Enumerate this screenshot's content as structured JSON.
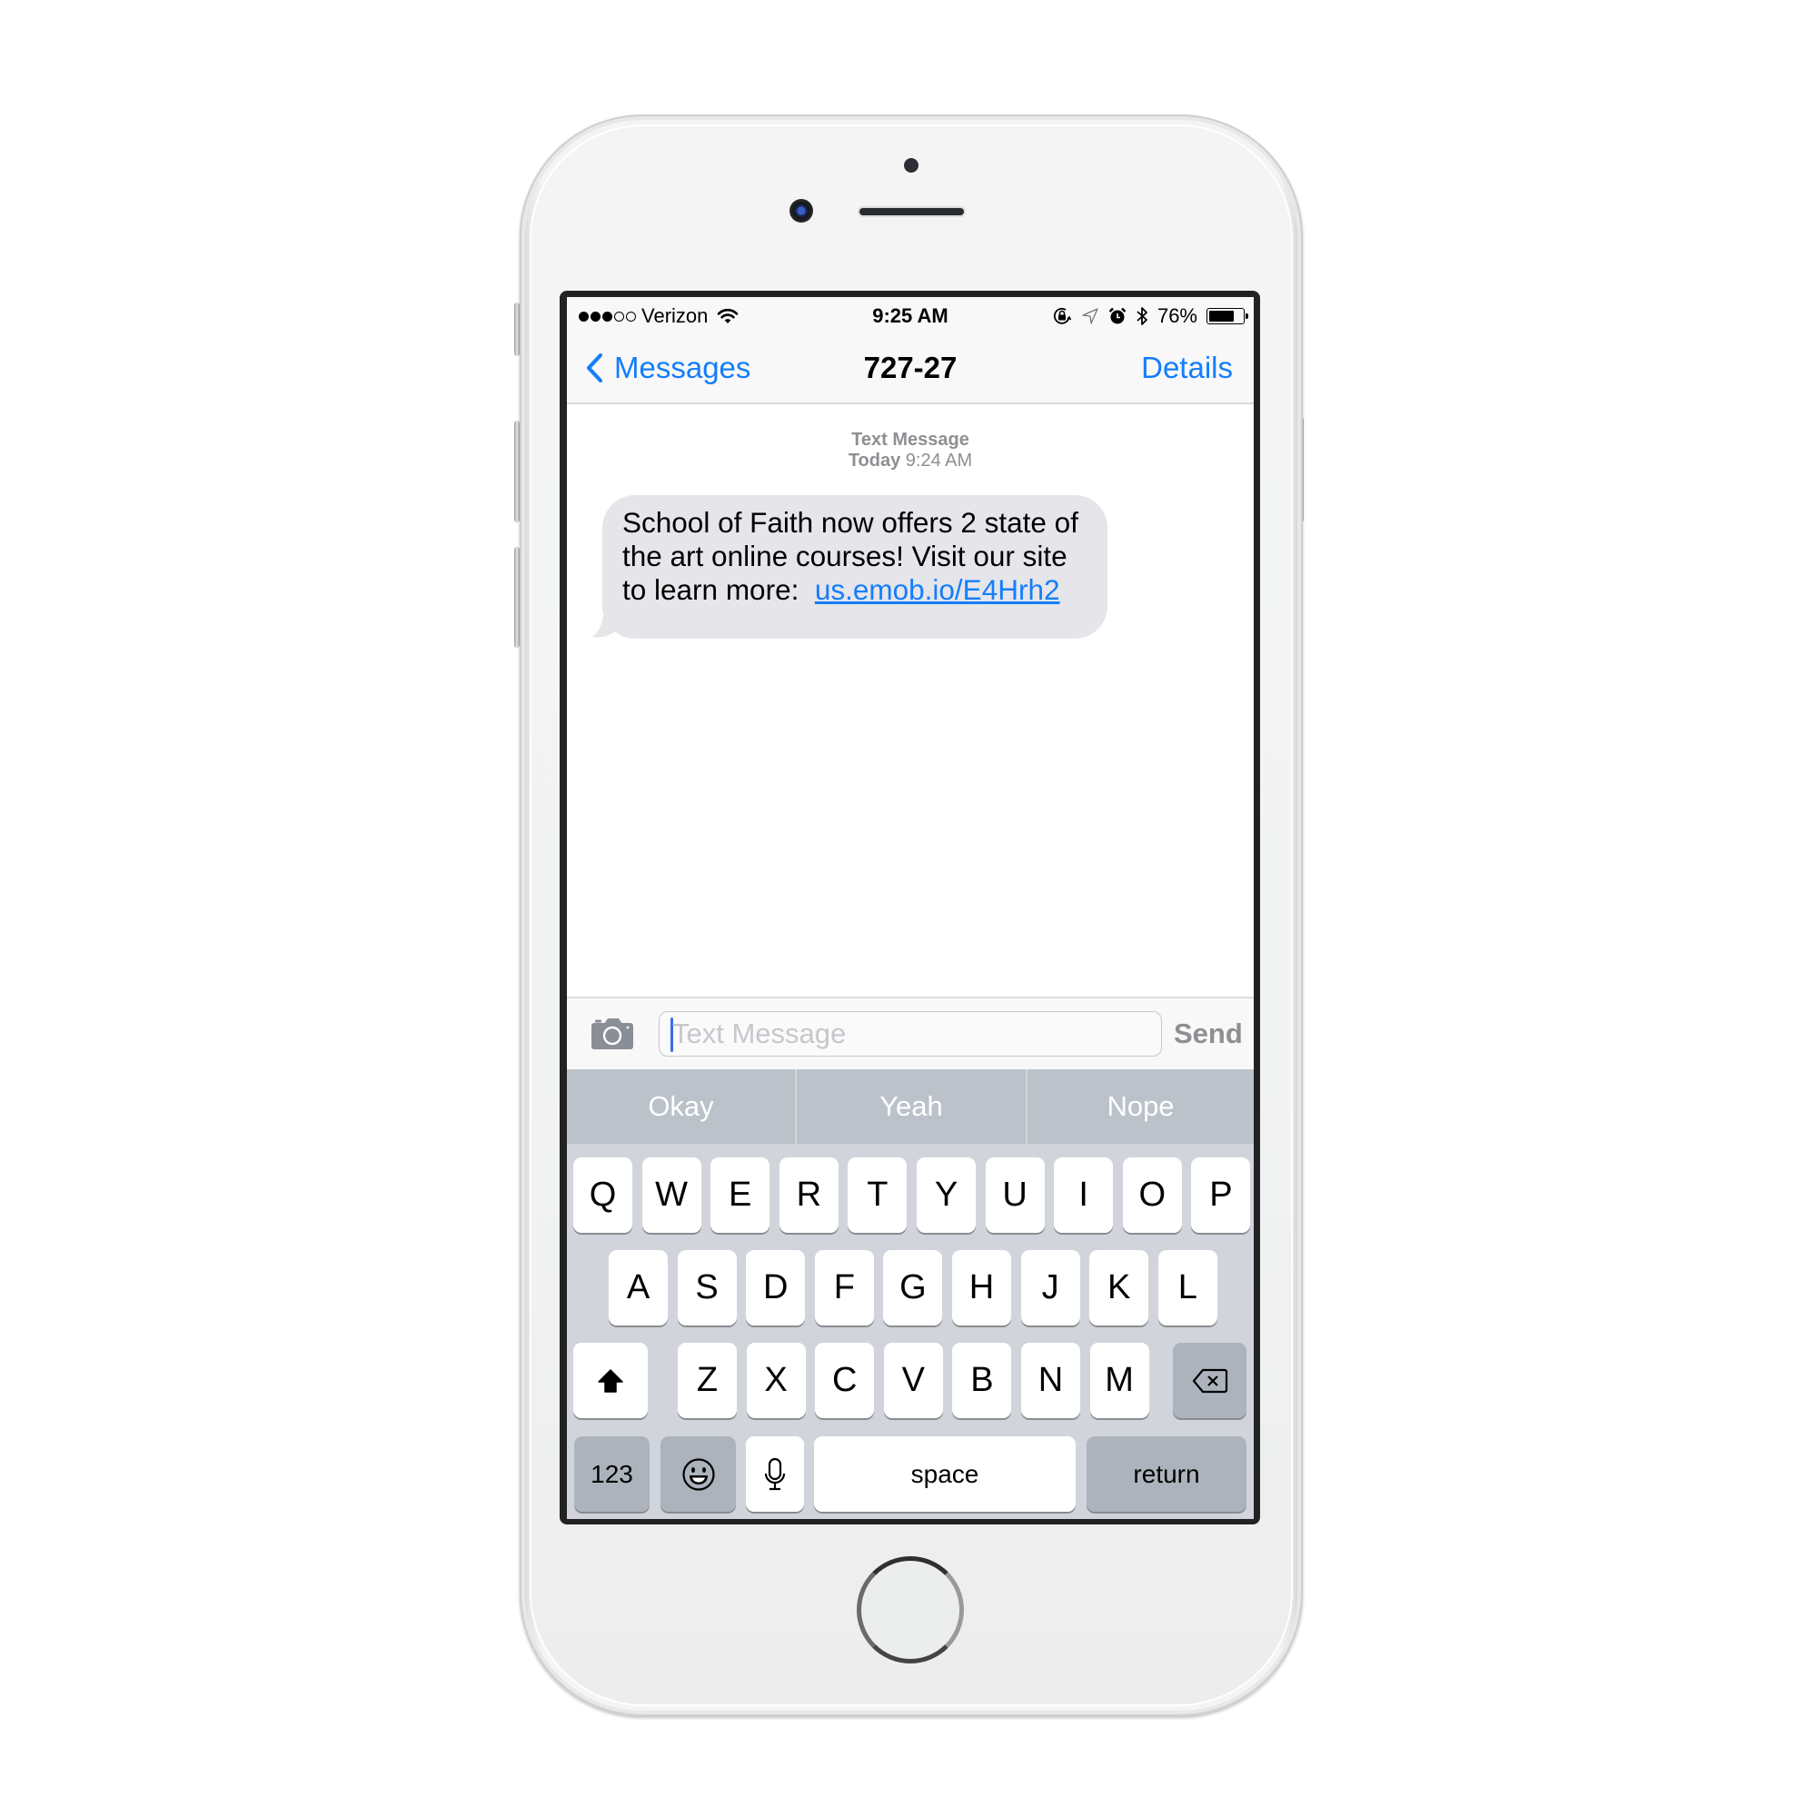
{
  "status_bar": {
    "signal_bars_filled": 3,
    "signal_bars_total": 5,
    "carrier": "Verizon",
    "time": "9:25 AM",
    "battery_text": "76%",
    "battery_level": 0.76,
    "icons": [
      "wifi-icon",
      "rotation-lock-icon",
      "location-icon",
      "alarm-icon",
      "bluetooth-icon",
      "battery-icon"
    ]
  },
  "nav": {
    "back_label": "Messages",
    "title": "727-27",
    "details_label": "Details"
  },
  "conversation": {
    "header_type": "Text Message",
    "header_day": "Today",
    "header_time": "9:24 AM",
    "messages": [
      {
        "direction": "incoming",
        "text_before_link": "School of Faith now offers 2 state of the art online courses! Visit our site to learn more:  ",
        "link_text": "us.emob.io/E4Hrh2"
      }
    ]
  },
  "composer": {
    "placeholder": "Text Message",
    "value": "",
    "send_label": "Send"
  },
  "quicktype": [
    "Okay",
    "Yeah",
    "Nope"
  ],
  "keyboard": {
    "row1": [
      "Q",
      "W",
      "E",
      "R",
      "T",
      "Y",
      "U",
      "I",
      "O",
      "P"
    ],
    "row2": [
      "A",
      "S",
      "D",
      "F",
      "G",
      "H",
      "J",
      "K",
      "L"
    ],
    "row3": [
      "Z",
      "X",
      "C",
      "V",
      "B",
      "N",
      "M"
    ],
    "numbers_label": "123",
    "space_label": "space",
    "return_label": "return"
  },
  "colors": {
    "accent": "#147efb",
    "bubble_incoming": "#e5e5ea",
    "keyboard_bg": "#d1d5db",
    "quicktype_bg": "#bcc2ca"
  }
}
